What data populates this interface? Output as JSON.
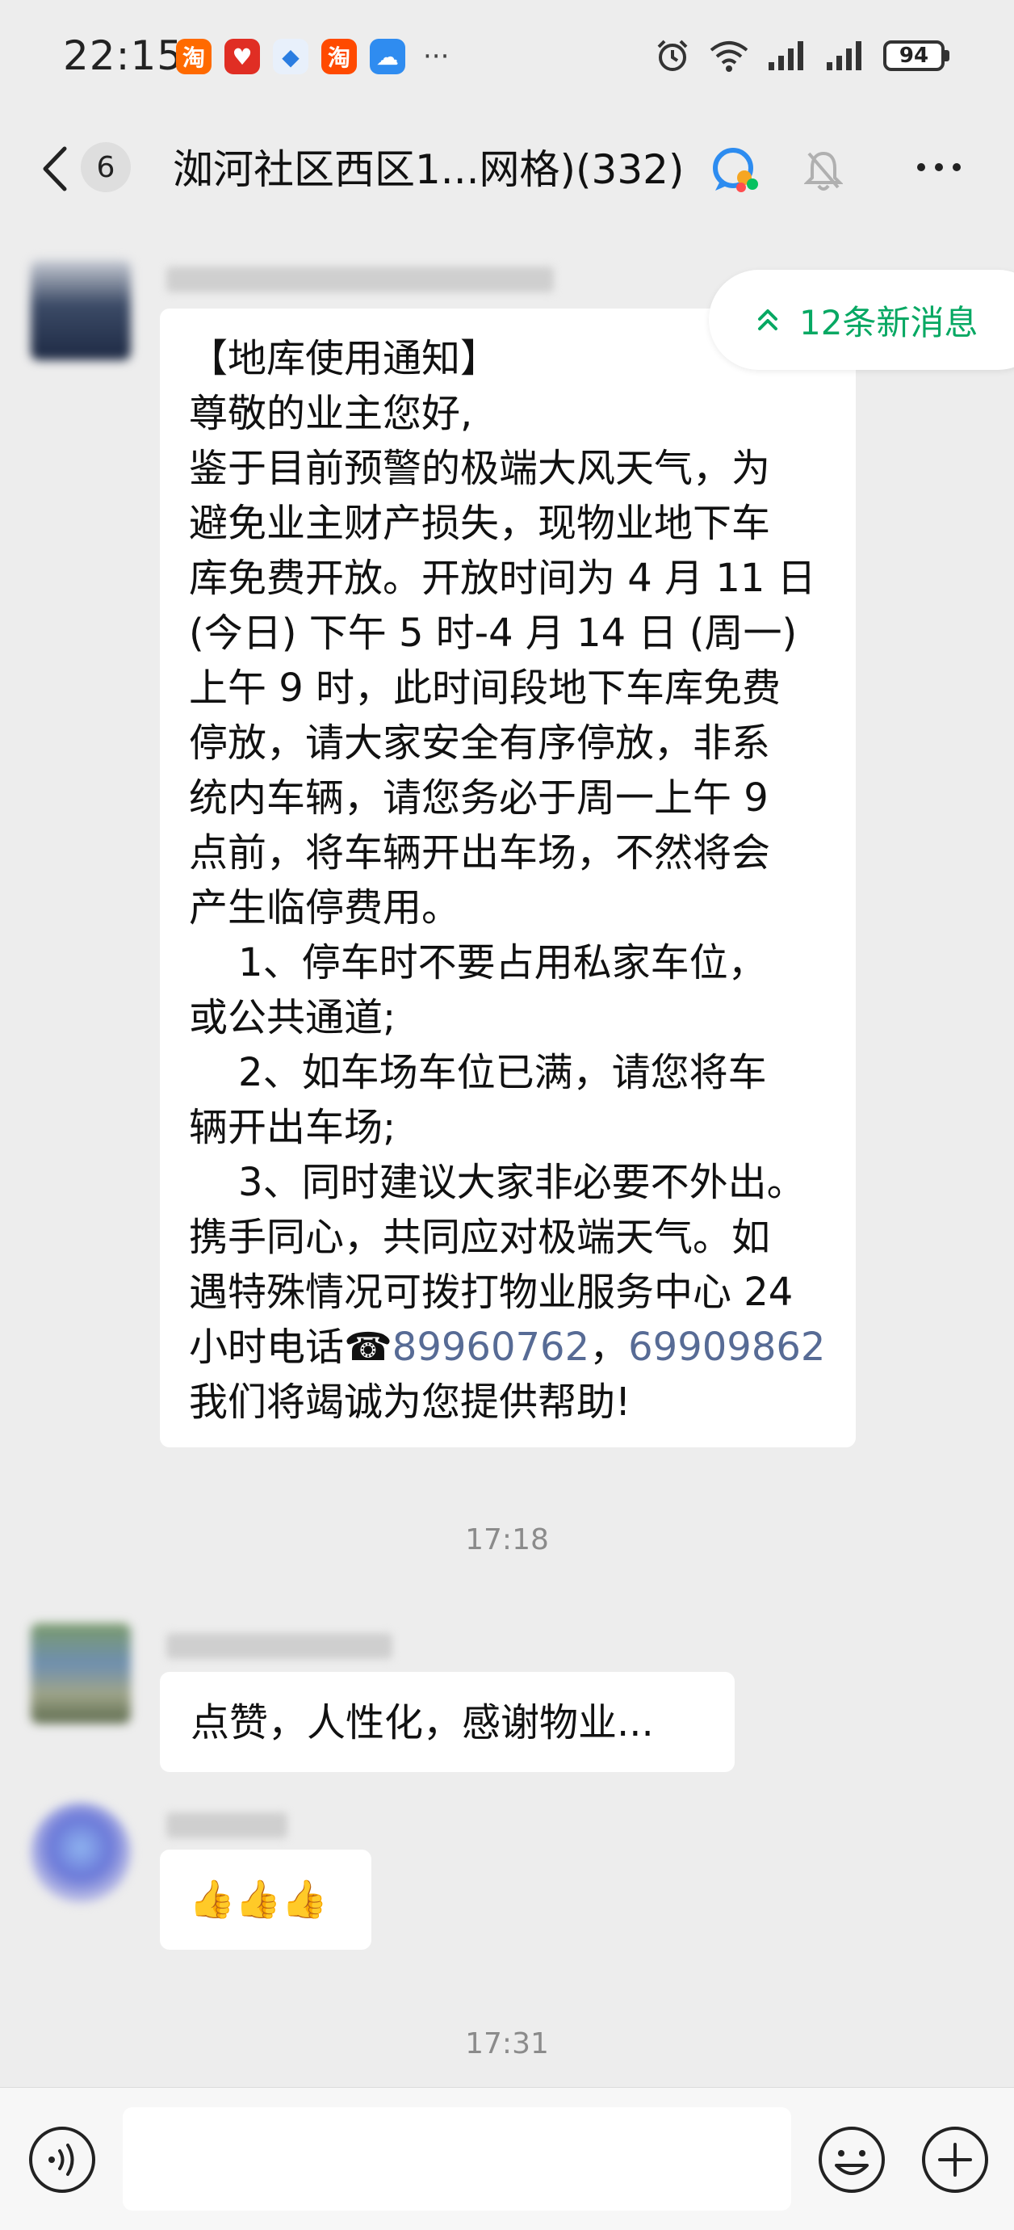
{
  "status_bar": {
    "time": "22:15",
    "battery": "94",
    "app_icons": [
      "taobao-icon",
      "pinduoduo-icon",
      "app-icon",
      "taobao-icon",
      "weather-icon"
    ],
    "more": "···"
  },
  "header": {
    "unread_count": "6",
    "title": "洳河社区西区1...网格)(332)"
  },
  "new_messages": "12条新消息",
  "messages": {
    "notice": {
      "lines": [
        "【地库使用通知】",
        "尊敬的业主您好,",
        "鉴于目前预警的极端大风天气，为",
        "避免业主财产损失，现物业地下车",
        "库免费开放。开放时间为 4 月 11 日",
        "(今日) 下午 5 时-4 月 14 日 (周一)",
        "上午 9 时，此时间段地下车库免费",
        "停放，请大家安全有序停放，非系",
        "统内车辆，请您务必于周一上午 9",
        "点前，将车辆开出车场，不然将会",
        "产生临停费用。",
        "    1、停车时不要占用私家车位，",
        "或公共通道;",
        "    2、如车场车位已满，请您将车",
        "辆开出车场;",
        "    3、同时建议大家非必要不外出。",
        "携手同心，共同应对极端天气。如",
        "遇特殊情况可拨打物业服务中心 24"
      ],
      "phone_prefix": "小时电话☎",
      "phone1": "89960762",
      "phone_sep": "，",
      "phone2": "69909862",
      "last_line": "我们将竭诚为您提供帮助!"
    },
    "time1": "17:18",
    "reply1": "点赞，人性化，感谢物业...",
    "reply2": "👍👍👍",
    "time2": "17:31"
  },
  "colors": {
    "background": "#ededed",
    "accent_green": "#07a863",
    "link_blue": "#576b95"
  }
}
